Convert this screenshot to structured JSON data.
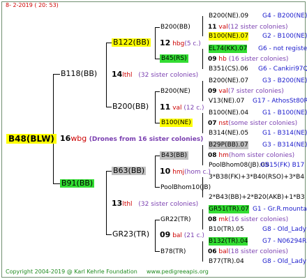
{
  "header": {
    "date": "8-  2-2019 ( 20: 53)"
  },
  "root": {
    "id": "B48(BLW)",
    "num": "16",
    "label": "wbg",
    "note": "(Drones from 16 sister colonies)"
  },
  "gen1": {
    "top": {
      "id": "B118(BB)",
      "num": "14",
      "label": "lthl",
      "note": "(32 sister colonies)"
    },
    "bottom": {
      "id": "B91(BB)",
      "num": "13",
      "label": "lthl",
      "note": "(32 sister colonies)"
    }
  },
  "gen2": {
    "a": {
      "id": "B122(BB)",
      "num": "12",
      "label": "hbg",
      "note": "(5 c.)"
    },
    "b": {
      "id": "B200(BB)",
      "num": "11",
      "label": "val",
      "note": "(12 c.)"
    },
    "c": {
      "id": "B63(BB)",
      "num": "10",
      "label": "hmj",
      "note": "(hom c.)"
    },
    "d": {
      "id": "GR23(TR)",
      "num": "09",
      "label": "bal",
      "note": "(21 c.)"
    }
  },
  "gen3": {
    "a": {
      "id": "B200(BB)",
      "num": "11",
      "label": "val",
      "note": "(12 sister colonies)"
    },
    "b": {
      "id": "B45(RS)",
      "num": "09",
      "label": "hb",
      "note": "(16 sister colonies)"
    },
    "c": {
      "id": "B200(NE)",
      "num": "09",
      "label": "val",
      "note": "(7 sister colonies)"
    },
    "d": {
      "id": "B100(NE)",
      "num": "07",
      "label": "nst",
      "note": "(some sister colonies)"
    },
    "e": {
      "id": "B43(BB)",
      "num": "08",
      "label": "hm",
      "note": "(hom sister colonies)"
    },
    "f": {
      "id": "PoolBhom10(JB)"
    },
    "g": {
      "id": "GR22(TR)",
      "num": "08",
      "label": "mk",
      "note": "(16 sister colonies)"
    },
    "h": {
      "id": "B78(TR)",
      "num": "06",
      "label": "bal",
      "note": "(18 sister colonies)"
    }
  },
  "gen4": [
    {
      "id": "B200(NE).09",
      "code": "G4 - B200(NE)"
    },
    {
      "id": "B100(NE).07",
      "code": "G2 - B100(NE)"
    },
    {
      "id": "EL74(KK).07",
      "code": "G6 - not registe"
    },
    {
      "id": "B351(CS).06",
      "code": "G6 - Cankiri97Q"
    },
    {
      "id": "B200(NE).07",
      "code": "G3 - B200(NE)"
    },
    {
      "id": "V13(NE).07",
      "code": "G17 - AthosSt80R"
    },
    {
      "id": "B100(NE).04",
      "code": "G1 - B100(NE)"
    },
    {
      "id": "B314(NE).05",
      "code": "G1 - B314(NE)"
    },
    {
      "id": "B29P(BB).07",
      "code": "G3 - B314(NE)"
    },
    {
      "id": "PoolBhom08(JB).05",
      "code": "GB15(FK) B17"
    },
    {
      "id": "3*B38(FK)+3*B40(RSO)+3*B4",
      "code": ""
    },
    {
      "id": "2*B43(BB)+2*B20(AKB)+1*B3",
      "code": ""
    },
    {
      "id": "GR51(TR).07",
      "code": "G1 - Gr.R.mounta"
    },
    {
      "id": "B10(TR).05",
      "code": "G8 - Old_Lady"
    },
    {
      "id": "B132(TR).04",
      "code": "G7 - N06294R"
    },
    {
      "id": "B77(TR).04",
      "code": "G8 - Old_Lady"
    }
  ],
  "footer": {
    "copyright": "Copyright 2004-2019 @ Karl Kehrle Foundation",
    "site": "www.pedigreeapis.org"
  },
  "colors": {
    "yellow": "#ffff00",
    "green": "#33dd33",
    "gray": "#c0c0c0",
    "blue": "#1a1acc",
    "red": "#cc0000",
    "purple": "#7a3fb0"
  }
}
